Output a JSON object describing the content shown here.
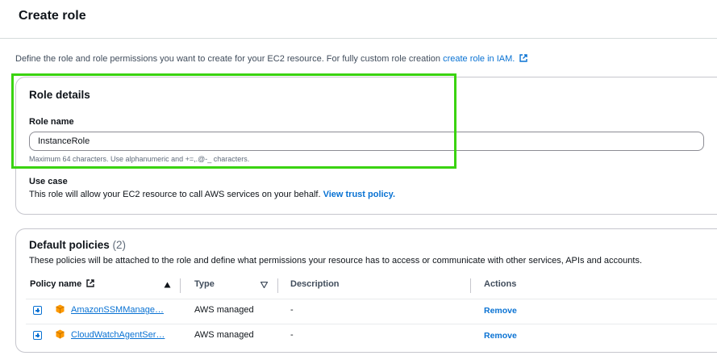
{
  "header": {
    "title": "Create role"
  },
  "intro": {
    "text": "Define the role and role permissions you want to create for your EC2 resource. For fully custom role creation ",
    "link": "create role in IAM."
  },
  "role_details": {
    "title": "Role details",
    "role_name_label": "Role name",
    "role_name_value": "InstanceRole",
    "role_name_hint": "Maximum 64 characters. Use alphanumeric and +=,.@-_ characters.",
    "use_case_label": "Use case",
    "use_case_text": "This role will allow your EC2 resource to call AWS services on your behalf. ",
    "use_case_link": "View trust policy."
  },
  "default_policies": {
    "title": "Default policies",
    "count": "(2)",
    "description": "These policies will be attached to the role and define what permissions your resource has to access or communicate with other services, APIs and accounts.",
    "columns": {
      "policy_name": "Policy name",
      "type": "Type",
      "description": "Description",
      "actions": "Actions"
    },
    "rows": [
      {
        "name": "AmazonSSMManage…",
        "type": "AWS managed",
        "description": "-",
        "action": "Remove"
      },
      {
        "name": "CloudWatchAgentSer…",
        "type": "AWS managed",
        "description": "-",
        "action": "Remove"
      }
    ]
  },
  "colors": {
    "link": "#0972d3",
    "highlight": "#3ad30f",
    "aws_orange": "#ff9900"
  },
  "icons": [
    "external-link-icon",
    "sort-ascending-icon",
    "sort-descending-icon",
    "expand-icon",
    "aws-service-icon"
  ]
}
